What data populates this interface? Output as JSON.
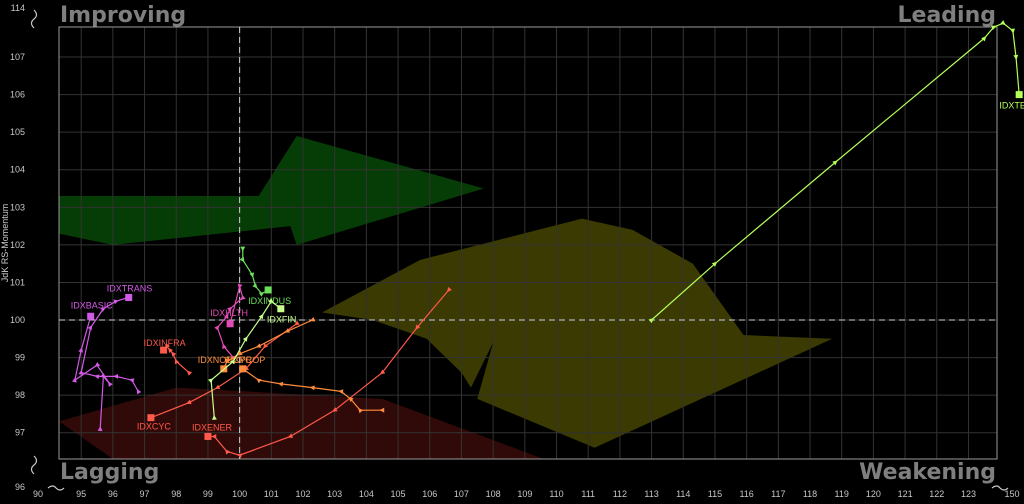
{
  "chart_data": {
    "type": "scatter",
    "variant": "relative-rotation-graph",
    "title": "",
    "xlabel": "",
    "ylabel": "JdK RS-Momentum",
    "x_axis_ticks": [
      "90",
      "95",
      "96",
      "97",
      "98",
      "99",
      "100",
      "101",
      "102",
      "103",
      "104",
      "105",
      "106",
      "107",
      "108",
      "109",
      "110",
      "111",
      "112",
      "113",
      "114",
      "115",
      "116",
      "117",
      "118",
      "119",
      "120",
      "121",
      "122",
      "123",
      "150"
    ],
    "y_axis_ticks": [
      "96",
      "97",
      "98",
      "99",
      "100",
      "101",
      "102",
      "103",
      "104",
      "105",
      "106",
      "107",
      "114"
    ],
    "xlim": [
      94.3,
      123.9
    ],
    "ylim": [
      96.3,
      107.8
    ],
    "x_axis_break": "left and right ends (90, 150)",
    "y_axis_break": "bottom and top ends (96, 114)",
    "center": [
      100,
      100
    ],
    "grid": true,
    "quadrants": {
      "top_left": "Improving",
      "top_right": "Leading",
      "bottom_left": "Lagging",
      "bottom_right": "Weakening"
    },
    "series": [
      {
        "name": "IDXTECH",
        "color": "#b5ff5a",
        "points": [
          [
            113.0,
            100.0
          ],
          [
            115.0,
            101.5
          ],
          [
            118.8,
            104.2
          ],
          [
            123.5,
            107.5
          ],
          [
            123.8,
            107.8
          ],
          [
            124.1,
            107.9
          ],
          [
            124.4,
            107.7
          ],
          [
            124.5,
            107.0
          ],
          [
            124.6,
            106.0
          ]
        ]
      },
      {
        "name": "IDXTRANS",
        "color": "#d25ae6",
        "points": [
          [
            96.8,
            98.1
          ],
          [
            96.6,
            98.4
          ],
          [
            96.1,
            98.5
          ],
          [
            95.5,
            98.5
          ],
          [
            95.0,
            98.6
          ],
          [
            95.3,
            99.8
          ],
          [
            95.7,
            100.3
          ],
          [
            96.1,
            100.5
          ],
          [
            96.5,
            100.6
          ]
        ]
      },
      {
        "name": "IDXBASIC",
        "color": "#d25ae6",
        "points": [
          [
            95.6,
            97.1
          ],
          [
            95.7,
            98.5
          ],
          [
            95.9,
            98.3
          ],
          [
            95.5,
            98.8
          ],
          [
            94.8,
            98.4
          ],
          [
            95.0,
            99.2
          ],
          [
            95.3,
            100.1
          ]
        ]
      },
      {
        "name": "IDXHLTH",
        "color": "#e24cb8",
        "points": [
          [
            99.8,
            99.0
          ],
          [
            99.5,
            99.3
          ],
          [
            99.3,
            99.8
          ],
          [
            99.6,
            100.1
          ],
          [
            99.7,
            100.3
          ],
          [
            100.1,
            100.6
          ],
          [
            100.0,
            100.9
          ],
          [
            99.7,
            99.9
          ]
        ]
      },
      {
        "name": "IDXINFRA",
        "color": "#ff5a4a",
        "points": [
          [
            98.4,
            98.6
          ],
          [
            98.0,
            98.9
          ],
          [
            97.9,
            99.1
          ],
          [
            97.8,
            99.2
          ],
          [
            97.7,
            99.3
          ],
          [
            97.6,
            99.2
          ]
        ]
      },
      {
        "name": "IDXCYC",
        "color": "#ff5a4a",
        "points": [
          [
            101.8,
            99.9
          ],
          [
            100.8,
            99.3
          ],
          [
            100.2,
            98.7
          ],
          [
            99.3,
            98.2
          ],
          [
            98.4,
            97.8
          ],
          [
            97.2,
            97.4
          ]
        ]
      },
      {
        "name": "IDXENER",
        "color": "#ff5a4a",
        "points": [
          [
            106.6,
            100.8
          ],
          [
            105.6,
            99.8
          ],
          [
            104.5,
            98.6
          ],
          [
            103.0,
            97.6
          ],
          [
            101.6,
            96.9
          ],
          [
            100.0,
            96.4
          ],
          [
            99.6,
            96.5
          ],
          [
            99.2,
            96.9
          ],
          [
            99.0,
            96.9
          ]
        ]
      },
      {
        "name": "IDXPROP",
        "color": "#ff8c3c",
        "points": [
          [
            104.5,
            97.6
          ],
          [
            103.8,
            97.6
          ],
          [
            103.5,
            97.9
          ],
          [
            103.2,
            98.1
          ],
          [
            102.3,
            98.2
          ],
          [
            101.3,
            98.3
          ],
          [
            100.6,
            98.4
          ],
          [
            100.1,
            98.7
          ]
        ]
      },
      {
        "name": "IDXNONCYC",
        "color": "#ff8c3c",
        "points": [
          [
            102.3,
            100.0
          ],
          [
            101.5,
            99.7
          ],
          [
            100.6,
            99.3
          ],
          [
            100.0,
            99.1
          ],
          [
            99.6,
            98.9
          ],
          [
            99.5,
            98.7
          ]
        ]
      },
      {
        "name": "IDXINDUS",
        "color": "#6ce05a",
        "points": [
          [
            100.1,
            101.9
          ],
          [
            100.1,
            101.6
          ],
          [
            100.4,
            101.2
          ],
          [
            100.5,
            100.9
          ],
          [
            100.7,
            100.7
          ],
          [
            100.9,
            100.8
          ]
        ]
      },
      {
        "name": "IDXFIN",
        "color": "#c8ff8c",
        "points": [
          [
            99.2,
            97.4
          ],
          [
            99.1,
            98.4
          ],
          [
            99.8,
            98.9
          ],
          [
            100.2,
            99.5
          ],
          [
            100.7,
            100.1
          ],
          [
            101.0,
            100.5
          ],
          [
            101.3,
            100.3
          ]
        ]
      }
    ]
  }
}
